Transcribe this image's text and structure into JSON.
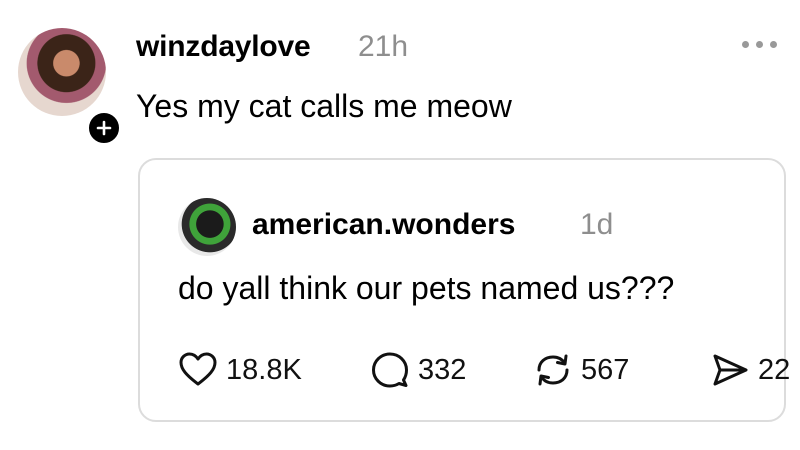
{
  "post": {
    "username": "winzdaylove",
    "time": "21h",
    "text": "Yes my cat calls me meow",
    "more_icon": "more-dots-icon",
    "follow_icon": "plus-icon"
  },
  "quoted_post": {
    "username": "american.wonders",
    "time": "1d",
    "text": "do yall think our pets named us???",
    "actions": {
      "likes": "18.8K",
      "replies": "332",
      "reposts": "567",
      "shares": "22"
    }
  }
}
